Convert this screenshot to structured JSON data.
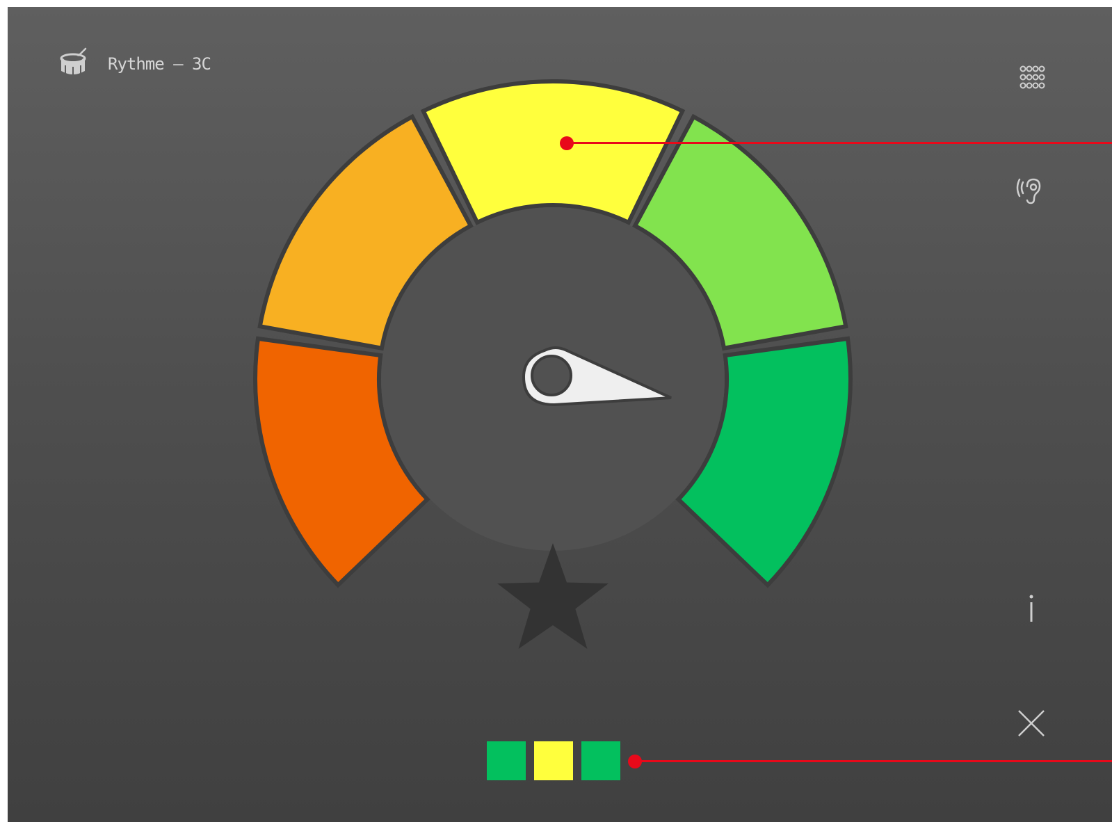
{
  "header": {
    "title": "Rythme – 3C",
    "icon": "drum-icon"
  },
  "sidebar": {
    "buttons": [
      {
        "name": "keypad-grid-button",
        "icon": "keypad-grid-icon"
      },
      {
        "name": "listen-button",
        "icon": "ear-icon"
      },
      {
        "name": "info-button",
        "icon": "info-icon"
      },
      {
        "name": "close-button",
        "icon": "close-icon"
      }
    ]
  },
  "gauge": {
    "segments": [
      {
        "label": "very-poor",
        "color": "#f06400"
      },
      {
        "label": "poor",
        "color": "#f8b022"
      },
      {
        "label": "average",
        "color": "#ffff3d"
      },
      {
        "label": "good",
        "color": "#82e34e"
      },
      {
        "label": "excellent",
        "color": "#03c05e"
      }
    ],
    "highlighted_segment": "average",
    "needle_color": "#efefef",
    "star_color": "#333333"
  },
  "results": {
    "squares": [
      {
        "color": "#03c05e"
      },
      {
        "color": "#ffff3d"
      },
      {
        "color": "#03c05e"
      }
    ]
  },
  "annotation": {
    "color": "#e8091a"
  }
}
